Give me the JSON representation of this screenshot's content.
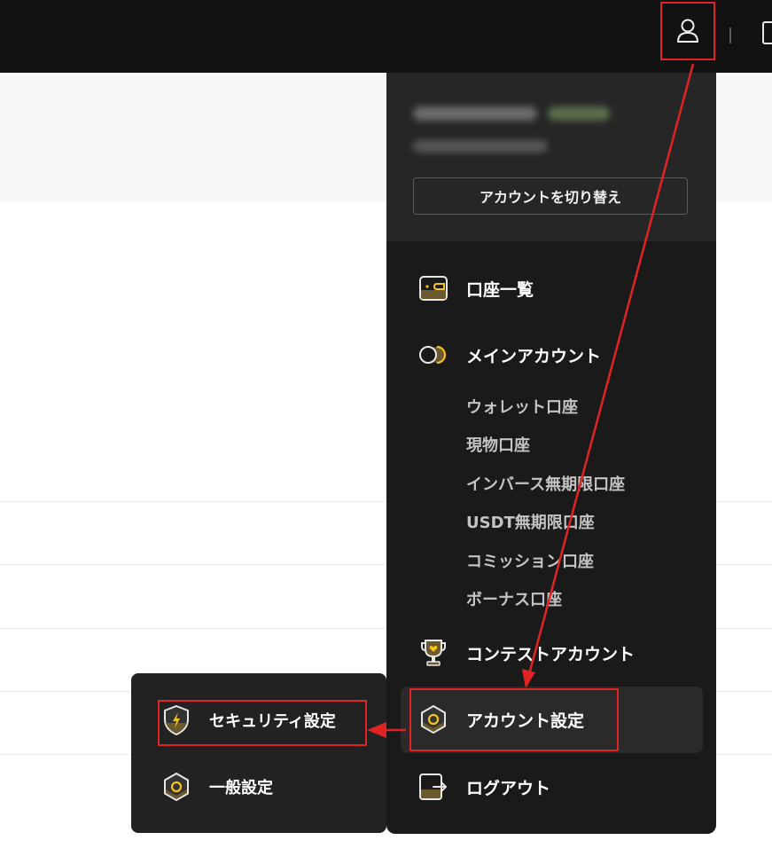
{
  "header": {
    "user_icon": "user-icon",
    "edge_icon": "checkbox-icon"
  },
  "profile": {
    "switch_label": "アカウントを切り替え"
  },
  "menu": {
    "accounts_list": {
      "label": "口座一覧",
      "icon": "wallet-icon"
    },
    "main_account": {
      "label": "メインアカウント",
      "icon": "coins-icon",
      "sub_items": [
        "ウォレット口座",
        "現物口座",
        "インバース無期限口座",
        "USDT無期限口座",
        "コミッション口座",
        "ボーナス口座"
      ]
    },
    "contest_account": {
      "label": "コンテストアカウント",
      "icon": "trophy-icon"
    },
    "account_settings": {
      "label": "アカウント設定",
      "icon": "hexagon-icon"
    },
    "logout": {
      "label": "ログアウト",
      "icon": "logout-icon"
    }
  },
  "submenu": {
    "security": {
      "label": "セキュリティ設定",
      "icon": "shield-lightning-icon"
    },
    "general": {
      "label": "一般設定",
      "icon": "hexagon-icon"
    }
  },
  "colors": {
    "accent": "#f7c21a",
    "annotation": "#e02424",
    "dropdown_bg": "#1a1a1a"
  }
}
